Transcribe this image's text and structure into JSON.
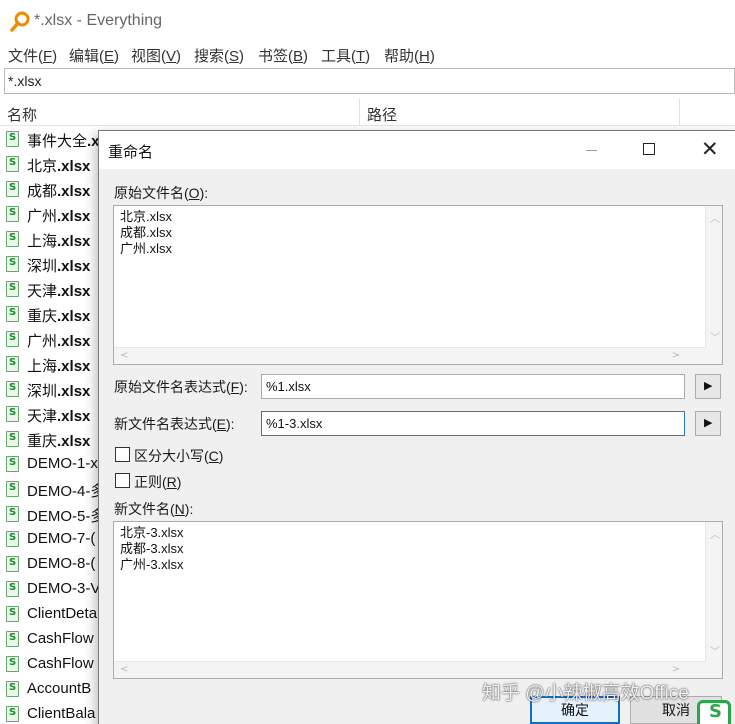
{
  "window": {
    "title": "*.xlsx - Everything"
  },
  "menu": [
    {
      "label": "文件(",
      "acc": "F",
      "end": ")"
    },
    {
      "label": "编辑(",
      "acc": "E",
      "end": ")"
    },
    {
      "label": "视图(",
      "acc": "V",
      "end": ")"
    },
    {
      "label": "搜索(",
      "acc": "S",
      "end": ")"
    },
    {
      "label": "书签(",
      "acc": "B",
      "end": ")"
    },
    {
      "label": "工具(",
      "acc": "T",
      "end": ")"
    },
    {
      "label": "帮助(",
      "acc": "H",
      "end": ")"
    }
  ],
  "search": {
    "value": "*.xlsx"
  },
  "columns": {
    "name": "名称",
    "path": "路径"
  },
  "files": [
    {
      "base": "事件大全",
      "ext": ".x"
    },
    {
      "base": "北京",
      "ext": ".xlsx"
    },
    {
      "base": "成都",
      "ext": ".xlsx"
    },
    {
      "base": "广州",
      "ext": ".xlsx"
    },
    {
      "base": "上海",
      "ext": ".xlsx"
    },
    {
      "base": "深圳",
      "ext": ".xlsx"
    },
    {
      "base": "天津",
      "ext": ".xlsx"
    },
    {
      "base": "重庆",
      "ext": ".xlsx"
    },
    {
      "base": "广州",
      "ext": ".xlsx"
    },
    {
      "base": "上海",
      "ext": ".xlsx"
    },
    {
      "base": "深圳",
      "ext": ".xlsx"
    },
    {
      "base": "天津",
      "ext": ".xlsx"
    },
    {
      "base": "重庆",
      "ext": ".xlsx"
    },
    {
      "base": "DEMO-1-x",
      "ext": ""
    },
    {
      "base": "DEMO-4-多",
      "ext": ""
    },
    {
      "base": "DEMO-5-多",
      "ext": ""
    },
    {
      "base": "DEMO-7-(",
      "ext": ""
    },
    {
      "base": "DEMO-8-(",
      "ext": ""
    },
    {
      "base": "DEMO-3-V",
      "ext": ""
    },
    {
      "base": "ClientDeta",
      "ext": ""
    },
    {
      "base": "CashFlow",
      "ext": ""
    },
    {
      "base": "CashFlow",
      "ext": ""
    },
    {
      "base": "AccountB",
      "ext": ""
    },
    {
      "base": "ClientBala",
      "ext": ""
    }
  ],
  "dialog": {
    "title": "重命名",
    "original_label": {
      "text": "原始文件名(",
      "acc": "O",
      "end": "):"
    },
    "original_names": [
      "北京.xlsx",
      "成都.xlsx",
      "广州.xlsx"
    ],
    "orig_expr_label": {
      "text": "原始文件名表达式(",
      "acc": "F",
      "end": "):"
    },
    "orig_expr_value": "%1.xlsx",
    "new_expr_label": {
      "text": "新文件名表达式(",
      "acc": "E",
      "end": "):"
    },
    "new_expr_value": "%1-3.xlsx",
    "case_label": {
      "text": "区分大小写(",
      "acc": "C",
      "end": ")"
    },
    "regex_label": {
      "text": "正则(",
      "acc": "R",
      "end": ")"
    },
    "new_names_label": {
      "text": "新文件名(",
      "acc": "N",
      "end": "):"
    },
    "new_names": [
      "北京-3.xlsx",
      "成都-3.xlsx",
      "广州-3.xlsx"
    ],
    "ok_label": "确定",
    "cancel_label": "取消",
    "arrow_glyph": "▶"
  },
  "watermark": "知乎 @小辣椒高效Office",
  "colors": {
    "accent": "#0f6fcf",
    "focus": "#2d7ac2",
    "excel_green": "#1f8a35"
  }
}
